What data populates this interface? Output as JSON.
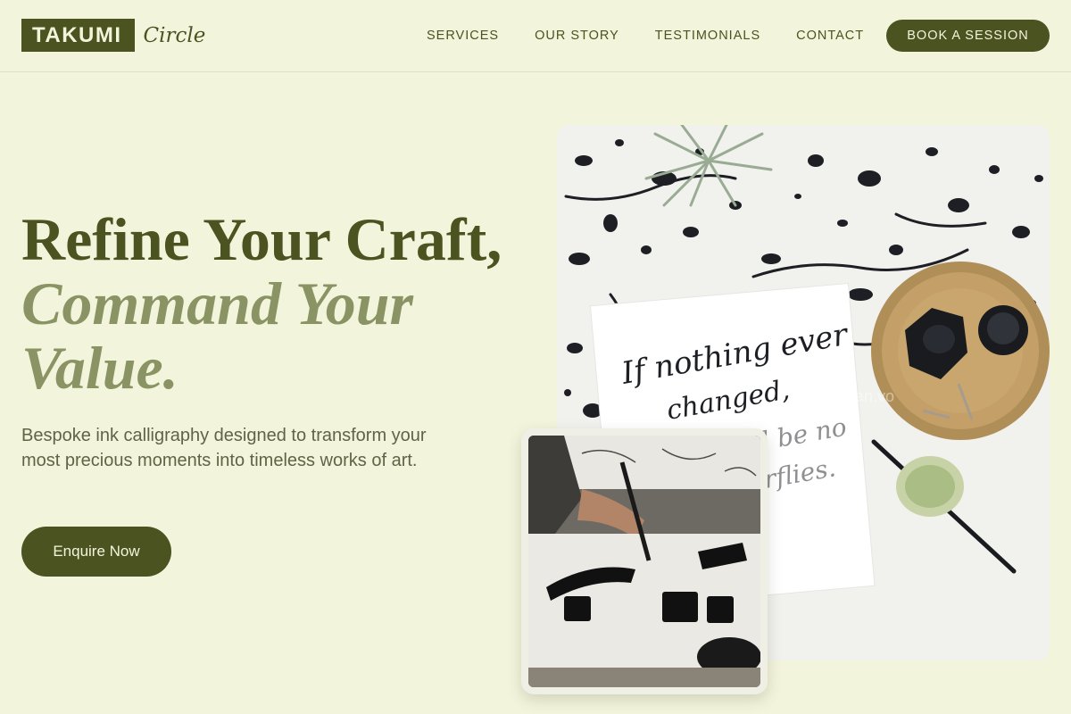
{
  "header": {
    "logo_box": "TAKUMI",
    "logo_script": "Circle",
    "nav": [
      "SERVICES",
      "OUR STORY",
      "TESTIMONIALS",
      "CONTACT"
    ],
    "cta_label": "BOOK A SESSION"
  },
  "hero": {
    "title_line1": "Refine Your Craft,",
    "title_line2a": "Command Your",
    "title_line2b": "Value.",
    "description": "Bespoke ink calligraphy designed to transform your most precious moments into timeless works of art.",
    "button_label": "Enquire Now"
  },
  "images": {
    "card_text_1": "If nothing ever",
    "card_text_2": "changed,",
    "card_text_3": "there'd be no",
    "card_text_4": "butterflies.",
    "watermark": "artisan.vo"
  },
  "colors": {
    "background": "#f3f4dc",
    "accent": "#4b5320",
    "accent_light": "#8a9363"
  }
}
